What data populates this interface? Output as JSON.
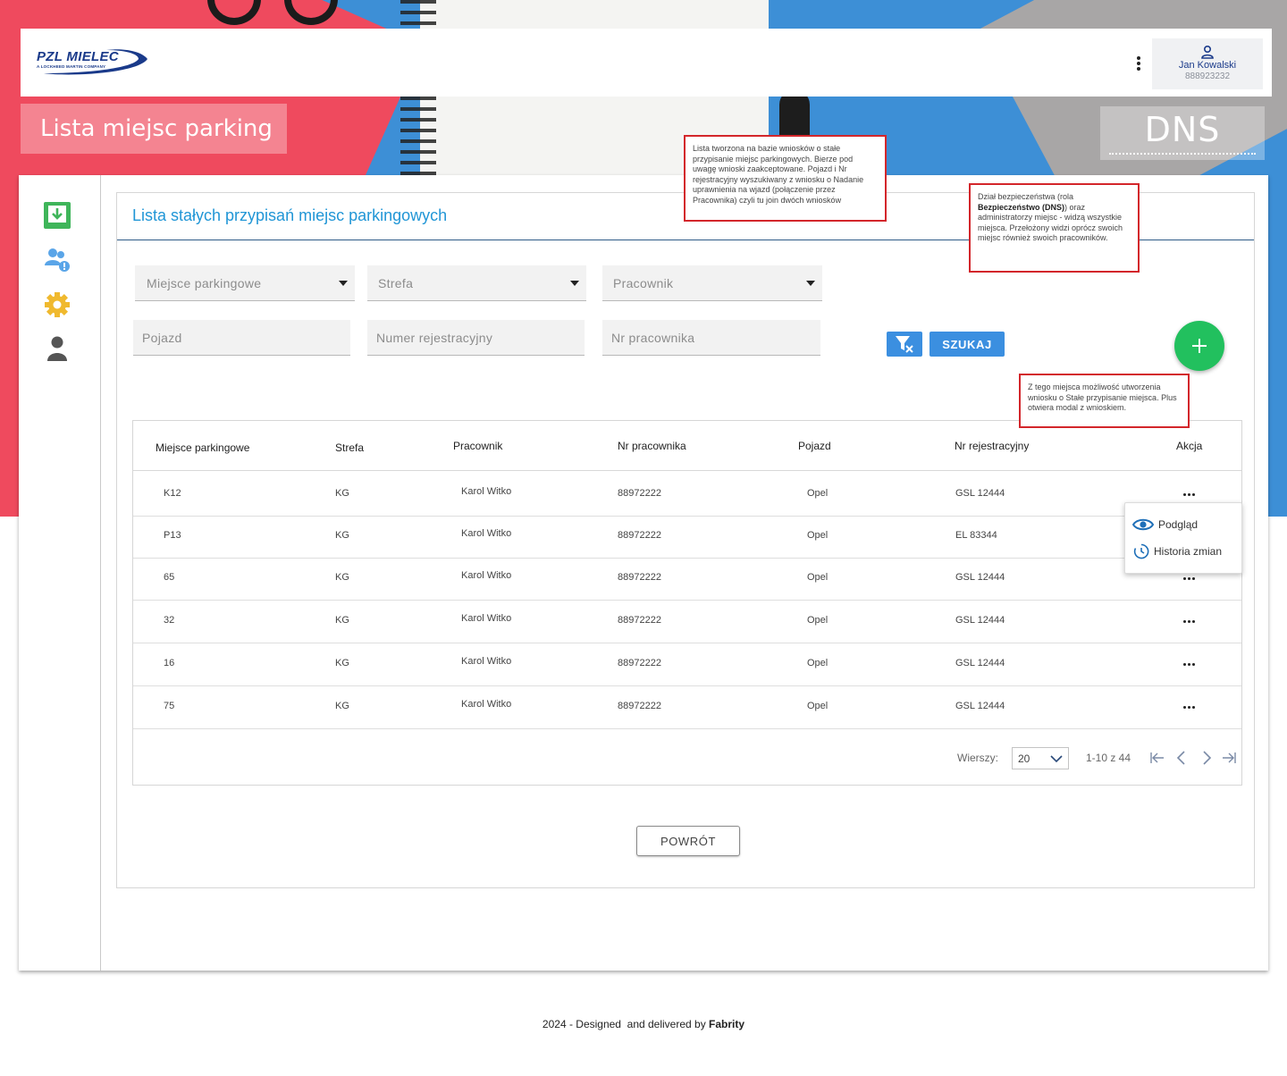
{
  "header": {
    "logo_main": "PZL MIELEC",
    "logo_sub": "A LOCKHEED MARTIN COMPANY",
    "user_name": "Jan Kowalski",
    "user_id": "888923232"
  },
  "page_title": "Lista miejsc parking",
  "role_label": "DNS",
  "sidebar": {
    "items": [
      {
        "icon": "download-box-icon"
      },
      {
        "icon": "users-alert-icon"
      },
      {
        "icon": "gear-icon"
      },
      {
        "icon": "person-icon"
      }
    ]
  },
  "content": {
    "title": "Lista stałych przypisań miejsc parkingowych"
  },
  "filters": {
    "parking_spot": "Miejsce parkingowe",
    "zone": "Strefa",
    "employee": "Pracownik",
    "vehicle": "Pojazd",
    "registration": "Numer rejestracyjny",
    "employee_no": "Nr pracownika",
    "search_button": "SZUKAJ"
  },
  "table": {
    "headers": [
      "Miejsce parkingowe",
      "Strefa",
      "Pracownik",
      "Nr pracownika",
      "Pojazd",
      "Nr rejestracyjny",
      "Akcja"
    ],
    "rows": [
      {
        "spot": "K12",
        "zone": "KG",
        "employee": "Karol Witko",
        "employee_no": "88972222",
        "vehicle": "Opel",
        "registration": "GSL 12444"
      },
      {
        "spot": "P13",
        "zone": "KG",
        "employee": "Karol Witko",
        "employee_no": "88972222",
        "vehicle": "Opel",
        "registration": "EL 83344"
      },
      {
        "spot": "65",
        "zone": "KG",
        "employee": "Karol Witko",
        "employee_no": "88972222",
        "vehicle": "Opel",
        "registration": "GSL 12444"
      },
      {
        "spot": "32",
        "zone": "KG",
        "employee": "Karol Witko",
        "employee_no": "88972222",
        "vehicle": "Opel",
        "registration": "GSL 12444"
      },
      {
        "spot": "16",
        "zone": "KG",
        "employee": "Karol Witko",
        "employee_no": "88972222",
        "vehicle": "Opel",
        "registration": "GSL 12444"
      },
      {
        "spot": "75",
        "zone": "KG",
        "employee": "Karol Witko",
        "employee_no": "88972222",
        "vehicle": "Opel",
        "registration": "GSL 12444"
      }
    ]
  },
  "pagination": {
    "rows_label": "Wierszy:",
    "rows_value": "20",
    "range": "1-10 z 44"
  },
  "row_menu": {
    "preview": "Podgląd",
    "history": "Historia zmian"
  },
  "back_button": "POWRÓT",
  "annotations": {
    "list_source": "Lista tworzona na bazie wniosków o stałe przypisanie miejsc parkingowych. Bierze pod uwagę wnioski zaakceptowane. Pojazd i Nr rejestracyjny wyszukiwany z wniosku o Nadanie uprawnienia na wjazd (połączenie przez Pracownika) czyli tu join dwóch wniosków",
    "security_prefix": "Dział bezpieczeństwa (rola ",
    "security_bold": "Bezpieczeństwo (DNS)",
    "security_suffix": ") oraz administratorzy miejsc - widzą wszystkie miejsca. Przełożony widzi oprócz swoich miejsc również swoich pracowników.",
    "create_request": "Z tego miejsca możliwość utworzenia wniosku o Stałe przypisanie miejsca. Plus otwiera modal z wnioskiem."
  },
  "footer": {
    "prefix": "2024 - Designed  and delivered by ",
    "brand": "Fabrity"
  },
  "colors": {
    "accent_blue": "#3b8fe0",
    "title_blue": "#2196d6",
    "fab_green": "#22c05e",
    "annotation_red": "#d3262b"
  }
}
